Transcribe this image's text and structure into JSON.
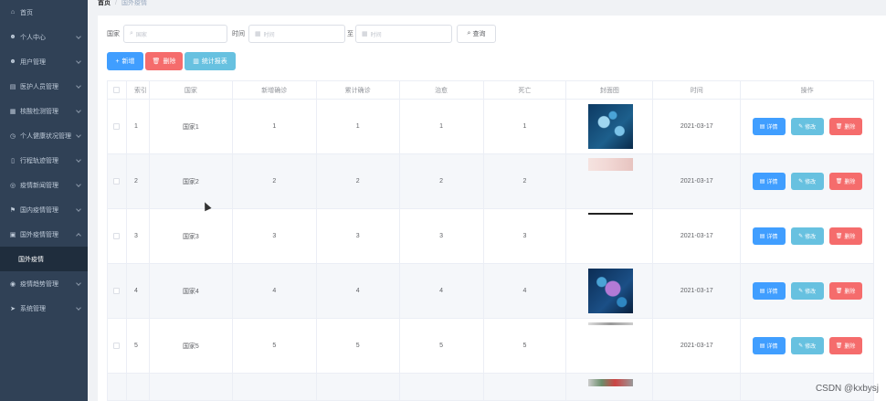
{
  "sidebar": {
    "items": [
      {
        "label": "首页",
        "icon": "home-icon",
        "glyph": "⌂",
        "arrow": false
      },
      {
        "label": "个人中心",
        "icon": "user-icon",
        "glyph": "☻",
        "arrow": true
      },
      {
        "label": "用户管理",
        "icon": "user-icon",
        "glyph": "☻",
        "arrow": true
      },
      {
        "label": "医护人员管理",
        "icon": "doc-icon",
        "glyph": "▤",
        "arrow": true
      },
      {
        "label": "核酸检测管理",
        "icon": "grid-icon",
        "glyph": "▦",
        "arrow": true
      },
      {
        "label": "个人健康状况管理",
        "icon": "clock-icon",
        "glyph": "◷",
        "arrow": true
      },
      {
        "label": "行程轨迹管理",
        "icon": "phone-icon",
        "glyph": "▯",
        "arrow": true
      },
      {
        "label": "疫情新闻管理",
        "icon": "globe-icon",
        "glyph": "◎",
        "arrow": true
      },
      {
        "label": "国内疫情管理",
        "icon": "flag-icon",
        "glyph": "⚑",
        "arrow": true
      },
      {
        "label": "国外疫情管理",
        "icon": "chart-icon",
        "glyph": "▣",
        "arrow": true,
        "open": true
      },
      {
        "label": "国外疫情",
        "submenu": true
      },
      {
        "label": "疫情趋势管理",
        "icon": "trend-icon",
        "glyph": "◉",
        "arrow": true
      },
      {
        "label": "系统管理",
        "icon": "send-icon",
        "glyph": "➤",
        "arrow": true
      }
    ]
  },
  "breadcrumb": {
    "home": "首页",
    "sep": "/",
    "current": "国外疫情"
  },
  "search": {
    "country_label": "国家",
    "country_placeholder": "国家",
    "time_label": "时间",
    "time_start_placeholder": "时间",
    "to_label": "至",
    "time_end_placeholder": "时间",
    "query_label": "查询"
  },
  "actions": {
    "add": "新增",
    "delete": "删除",
    "stats": "统计报表"
  },
  "table": {
    "headers": [
      "索引",
      "国家",
      "新增确诊",
      "累计确诊",
      "治愈",
      "死亡",
      "封面图",
      "时间",
      "操作"
    ],
    "rows": [
      {
        "index": "1",
        "country": "国家1",
        "new": "1",
        "total": "1",
        "cured": "1",
        "dead": "1",
        "img": "v1",
        "time": "2021-03-17"
      },
      {
        "index": "2",
        "country": "国家2",
        "new": "2",
        "total": "2",
        "cured": "2",
        "dead": "2",
        "img": "v2",
        "time": "2021-03-17"
      },
      {
        "index": "3",
        "country": "国家3",
        "new": "3",
        "total": "3",
        "cured": "3",
        "dead": "3",
        "img": "v3",
        "time": "2021-03-17"
      },
      {
        "index": "4",
        "country": "国家4",
        "new": "4",
        "total": "4",
        "cured": "4",
        "dead": "4",
        "img": "v4",
        "time": "2021-03-17"
      },
      {
        "index": "5",
        "country": "国家5",
        "new": "5",
        "total": "5",
        "cured": "5",
        "dead": "5",
        "img": "v5",
        "time": "2021-03-17"
      }
    ],
    "row_actions": {
      "detail": "详情",
      "edit": "修改",
      "remove": "删除"
    }
  },
  "watermark": "CSDN @kxbysj"
}
